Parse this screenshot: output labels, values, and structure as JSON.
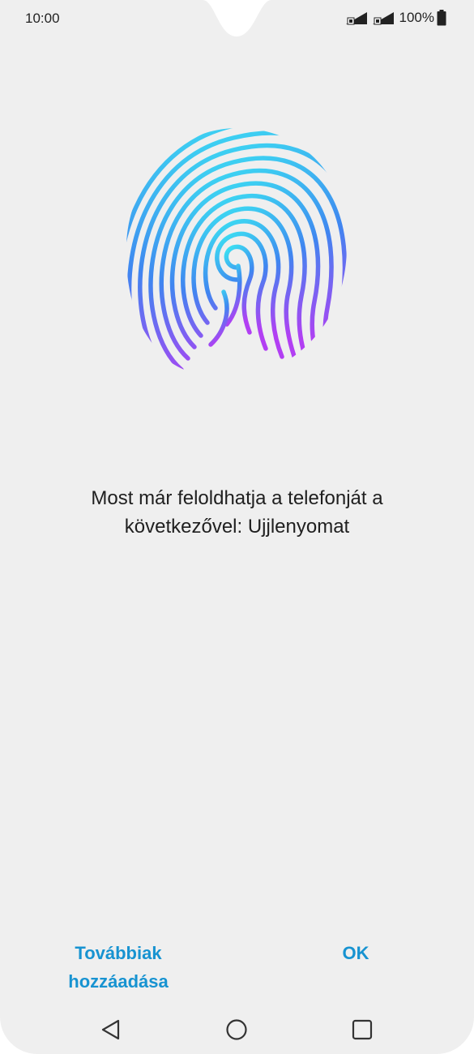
{
  "status_bar": {
    "time": "10:00",
    "battery": "100%",
    "icons": [
      "sim1-signal-icon",
      "sim2-signal-icon",
      "battery-icon"
    ]
  },
  "content": {
    "graphic": "fingerprint-icon",
    "message": "Most már feloldhatja a telefonját a következővel: Ujjlenyomat"
  },
  "buttons": {
    "add_more_label": "Továbbiak hozzáadása",
    "ok_label": "OK"
  },
  "navigation": {
    "icons": [
      "back-icon",
      "home-icon",
      "recent-apps-icon"
    ]
  },
  "colors": {
    "accent": "#1793d1",
    "background": "#efefef",
    "fingerprint_top": "#3ce5f2",
    "fingerprint_mid": "#3f86f0",
    "fingerprint_bottom": "#b23ff3"
  }
}
